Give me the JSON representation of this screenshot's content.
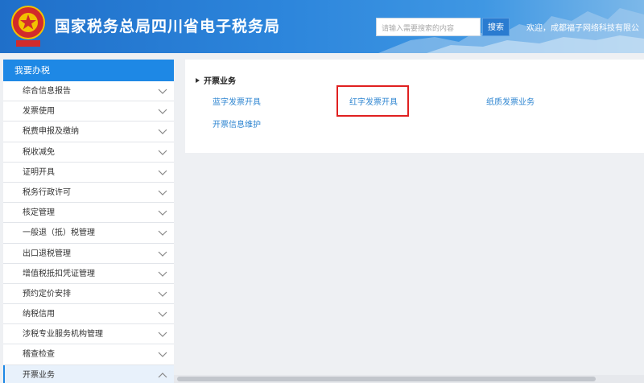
{
  "header": {
    "title": "国家税务总局四川省电子税务局",
    "search_placeholder": "请输入需要搜索的内容",
    "search_button": "搜索",
    "welcome": "欢迎，成都福子网络科技有限公"
  },
  "sidebar": {
    "heading": "我要办税",
    "items": [
      {
        "label": "综合信息报告"
      },
      {
        "label": "发票使用"
      },
      {
        "label": "税费申报及缴纳"
      },
      {
        "label": "税收减免"
      },
      {
        "label": "证明开具"
      },
      {
        "label": "税务行政许可"
      },
      {
        "label": "核定管理"
      },
      {
        "label": "一般退（抵）税管理"
      },
      {
        "label": "出口退税管理"
      },
      {
        "label": "增值税抵扣凭证管理"
      },
      {
        "label": "预约定价安排"
      },
      {
        "label": "纳税信用"
      },
      {
        "label": "涉税专业服务机构管理"
      },
      {
        "label": "稽查检查"
      },
      {
        "label": "开票业务"
      }
    ]
  },
  "main": {
    "section_title": "开票业务",
    "links": {
      "blue_invoice": "蓝字发票开具",
      "red_invoice": "红字发票开具",
      "paper_invoice": "纸质发票业务",
      "invoice_info": "开票信息维护"
    }
  },
  "colors": {
    "header_blue": "#1f6fc9",
    "sidebar_head": "#1e88e5",
    "link_blue": "#2f86d1",
    "highlight_red": "#e02020"
  }
}
